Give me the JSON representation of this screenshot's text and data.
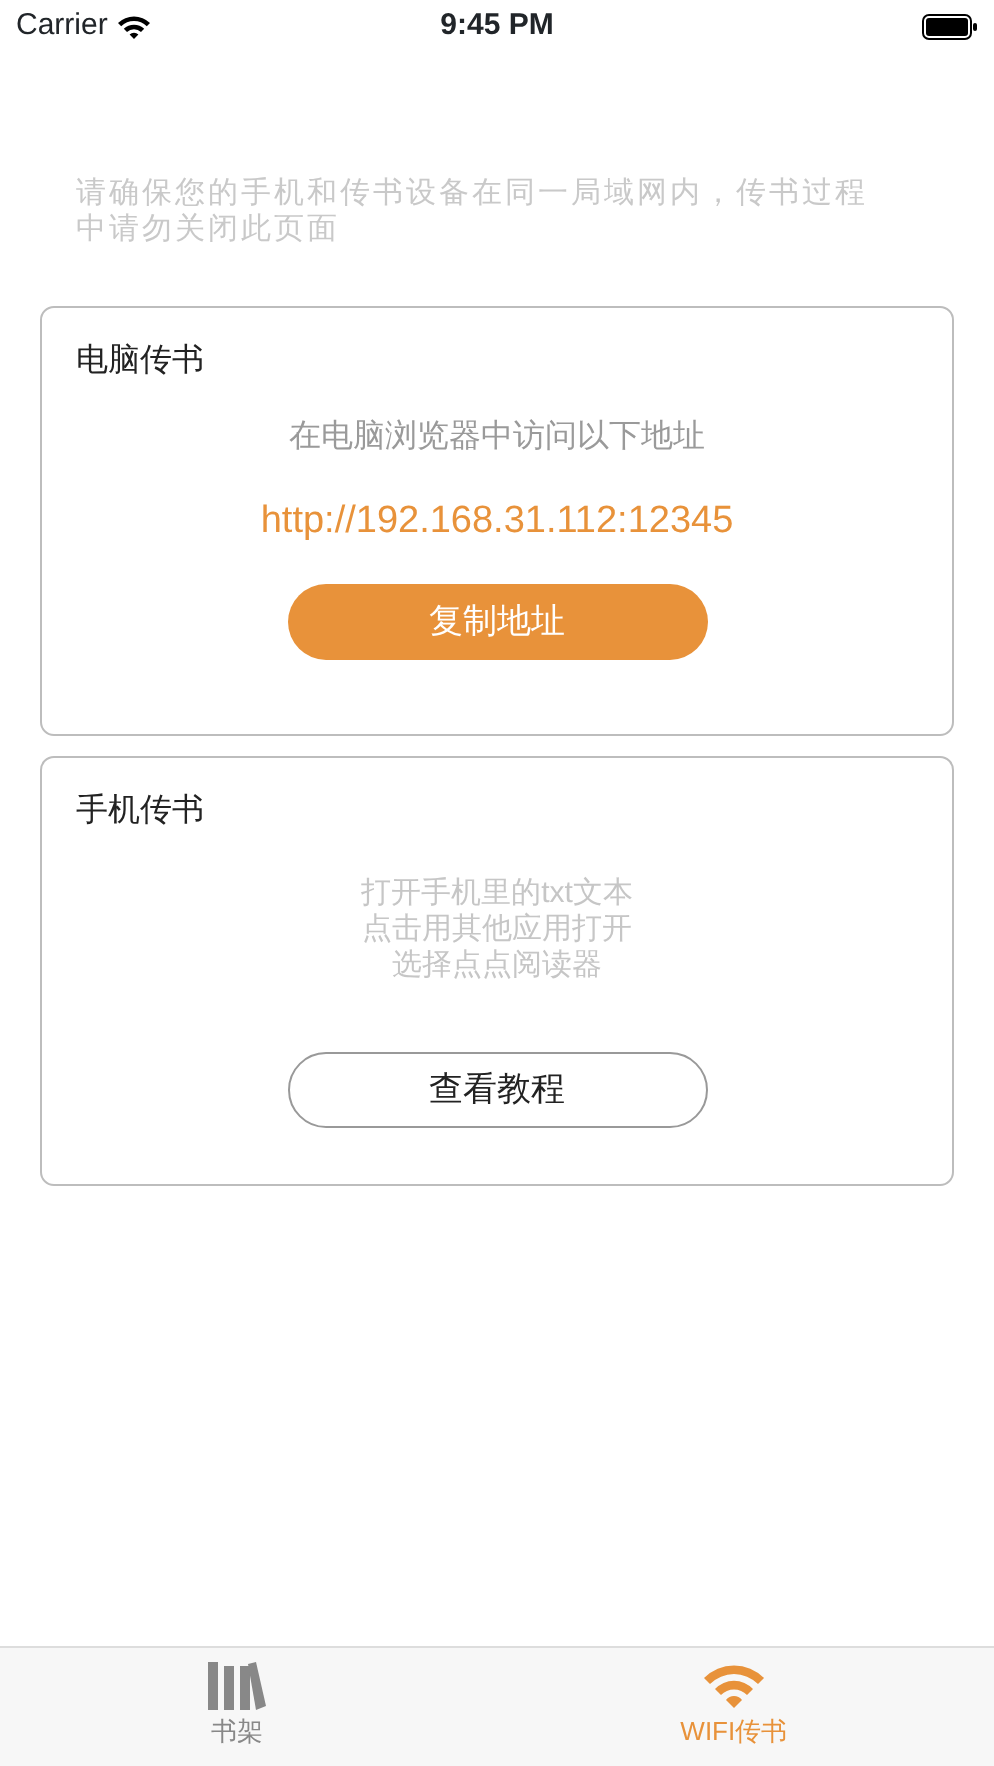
{
  "status_bar": {
    "carrier": "Carrier",
    "time": "9:45 PM"
  },
  "notice": "请确保您的手机和传书设备在同一局域网内，传书过程中请勿关闭此页面",
  "cards": [
    {
      "kind": "computer",
      "title": "电脑传书",
      "subtitle": "在电脑浏览器中访问以下地址",
      "address": "http://192.168.31.112:12345",
      "button": "复制地址"
    },
    {
      "kind": "phone",
      "title": "手机传书",
      "lines": [
        "打开手机里的txt文本",
        "点击用其他应用打开",
        "选择点点阅读器"
      ],
      "button": "查看教程"
    }
  ],
  "tabs": [
    {
      "kind": "books",
      "label": "书架",
      "selected": false
    },
    {
      "kind": "wifi",
      "label": "WIFI传书",
      "selected": true
    }
  ]
}
